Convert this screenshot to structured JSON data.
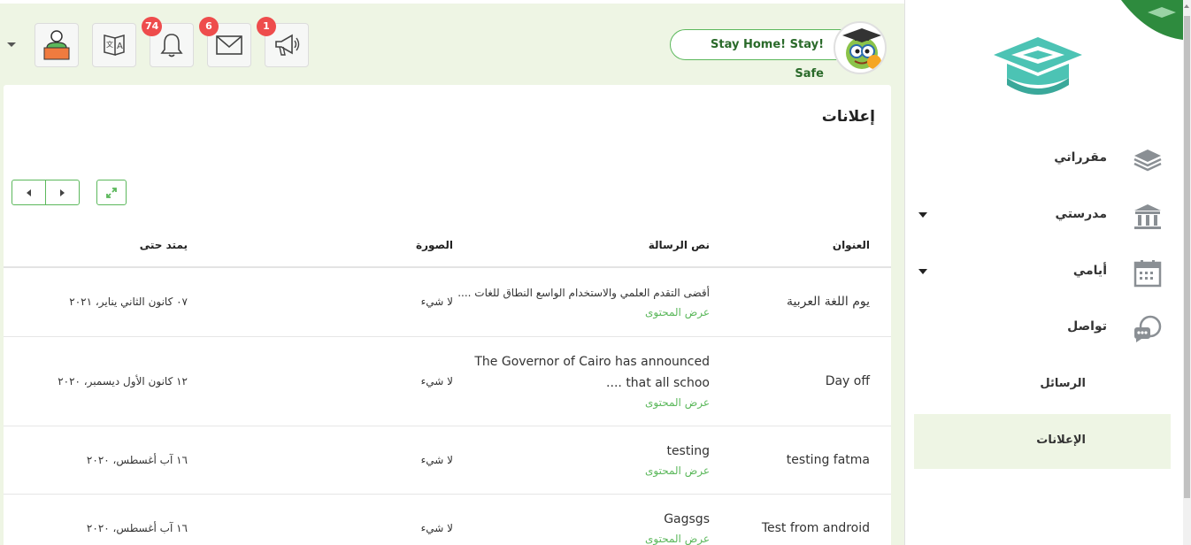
{
  "header": {
    "greeting": "!Stay Home! Stay Safe",
    "badges": {
      "notifications": "74",
      "messages": "6",
      "announcements": "1"
    },
    "icons": {
      "user": "user-at-laptop-icon",
      "translate": "translate-icon",
      "notifications": "bell-icon",
      "messages": "envelope-icon",
      "announcements": "megaphone-icon"
    }
  },
  "card": {
    "title": "إعلانات",
    "columns": {
      "title": "العنوان",
      "message": "نص الرسالة",
      "image": "الصورة",
      "until": "يمتد حتى"
    },
    "rows": [
      {
        "title": "يوم اللغة العربية",
        "message_lines": [
          "أقضى التقدم العلمي والاستخدام الواسع النطاق للغات ...."
        ],
        "message_link": "عرض المحتوى",
        "image": "لا شيء",
        "until": "٠٧ كانون الثاني يناير، ٢٠٢١"
      },
      {
        "title": "Day off",
        "message_lines": [
          "The Governor of Cairo has announced",
          "that all schoo ...."
        ],
        "message_link": "عرض المحتوى",
        "image": "لا شيء",
        "until": "١٢ كانون الأول ديسمبر، ٢٠٢٠"
      },
      {
        "title": "testing fatma",
        "message_lines": [
          "testing"
        ],
        "message_link": "عرض المحتوى",
        "image": "لا شيء",
        "until": "١٦ آب أغسطس، ٢٠٢٠"
      },
      {
        "title": "Test from android",
        "message_lines": [
          "Gagsgs"
        ],
        "message_link": "عرض المحتوى",
        "image": "لا شيء",
        "until": "١٦ آب أغسطس، ٢٠٢٠"
      }
    ]
  },
  "sidebar": {
    "items": [
      {
        "label": "مقرراتي",
        "icon": "books-stack-icon",
        "has_caret": false
      },
      {
        "label": "مدرستي",
        "icon": "school-building-icon",
        "has_caret": true
      },
      {
        "label": "أيامي",
        "icon": "calendar-icon",
        "has_caret": true
      },
      {
        "label": "تواصل",
        "icon": "chat-bubbles-icon",
        "has_caret": false
      }
    ],
    "sub_items": [
      {
        "label": "الرسائل",
        "active": false
      },
      {
        "label": "الإعلانات",
        "active": true
      }
    ]
  },
  "colors": {
    "accent_green": "#5cb85c",
    "badge_red": "#ee4c4c",
    "logo_teal": "#4cc3b4",
    "page_bg": "#eef5e4"
  }
}
